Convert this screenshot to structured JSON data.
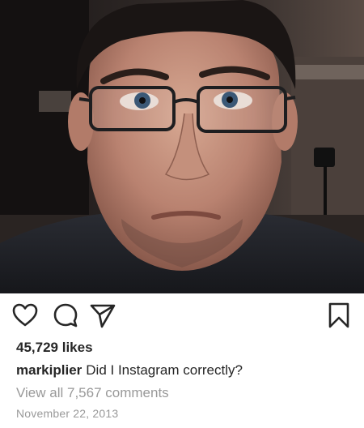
{
  "photo": {
    "subject": "selfie-photo"
  },
  "actions": {
    "like_icon": "heart-outline-icon",
    "comment_icon": "speech-bubble-icon",
    "share_icon": "paper-plane-icon",
    "save_icon": "bookmark-outline-icon"
  },
  "likes_text": "45,729 likes",
  "caption": {
    "username": "markiplier",
    "text": "Did I Instagram correctly?"
  },
  "view_comments_text": "View all 7,567 comments",
  "date_text": "November 22, 2013",
  "colors": {
    "text": "#262626",
    "muted": "#999999",
    "background": "#ffffff"
  }
}
